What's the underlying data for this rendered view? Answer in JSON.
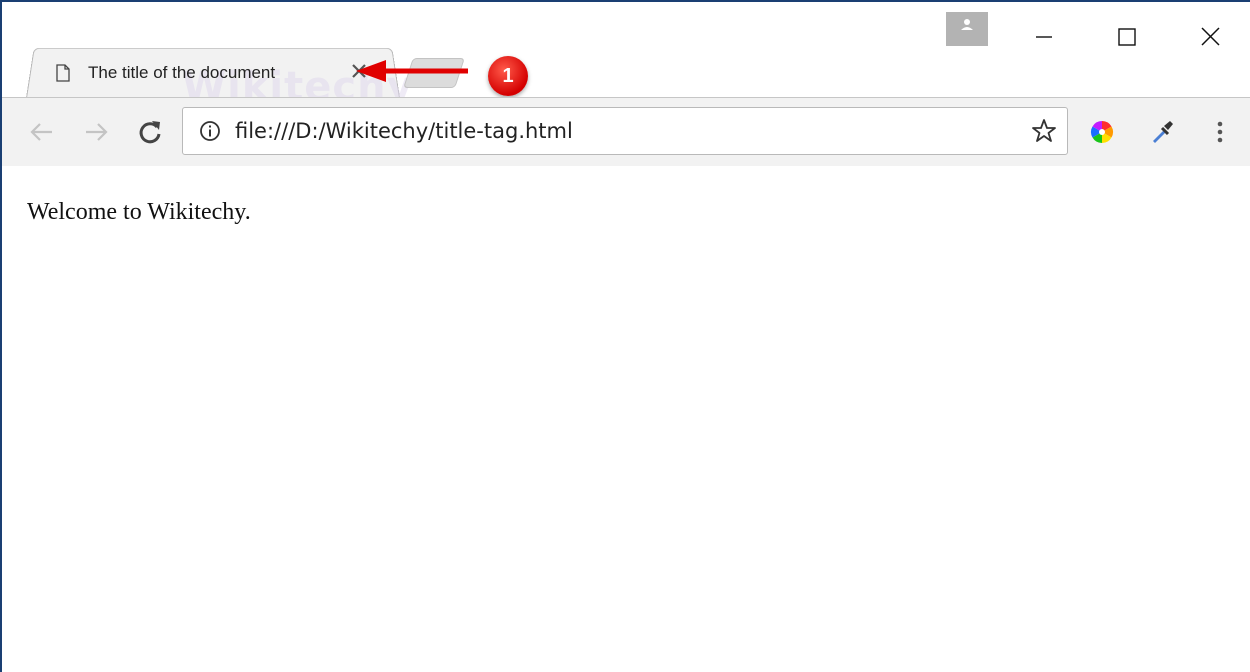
{
  "tab": {
    "title": "The title of the document",
    "page_icon": "page-icon",
    "close_icon": "close-icon"
  },
  "watermark": {
    "text": "Wikitechy"
  },
  "window_controls": {
    "profile_icon": "person-icon",
    "minimize_icon": "minimize-icon",
    "maximize_icon": "maximize-icon",
    "close_icon": "close-icon"
  },
  "toolbar": {
    "back_icon": "arrow-left-icon",
    "forward_icon": "arrow-right-icon",
    "reload_icon": "reload-icon",
    "url": "file:///D:/Wikitechy/title-tag.html",
    "info_icon": "info-icon",
    "bookmark_icon": "star-icon",
    "extensions": [
      "color-wheel-icon",
      "eyedropper-icon"
    ],
    "menu_icon": "kebab-menu-icon"
  },
  "page": {
    "text": "Welcome to Wikitechy."
  },
  "annotation": {
    "badge": "1",
    "color": "#e00000"
  }
}
